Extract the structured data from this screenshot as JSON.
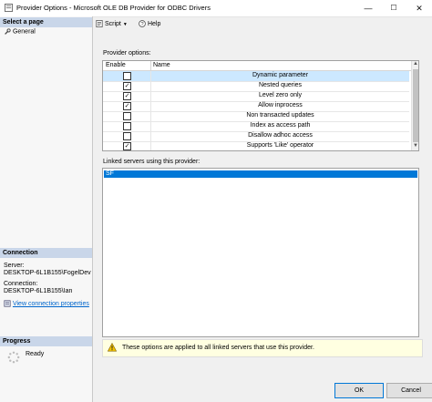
{
  "window": {
    "title": "Provider Options - Microsoft OLE DB Provider for ODBC Drivers",
    "minimize": "—",
    "maximize": "☐",
    "close": "✕"
  },
  "left": {
    "select_page_header": "Select a page",
    "pages": [
      {
        "label": "General",
        "icon": "wrench-icon"
      }
    ],
    "connection_header": "Connection",
    "server_label": "Server:",
    "server_value": "DESKTOP-6L1B155\\FogelDev",
    "connection_label": "Connection:",
    "connection_value": "DESKTOP-6L1B155\\Ian",
    "view_props_link": "View connection properties",
    "progress_header": "Progress",
    "progress_status": "Ready"
  },
  "toolbar": {
    "script_label": "Script",
    "help_label": "Help"
  },
  "options": {
    "label": "Provider options:",
    "columns": [
      "Enable",
      "Name"
    ],
    "rows": [
      {
        "name": "Dynamic parameter",
        "checked": false,
        "selected": true
      },
      {
        "name": "Nested queries",
        "checked": true,
        "selected": false
      },
      {
        "name": "Level zero only",
        "checked": true,
        "selected": false
      },
      {
        "name": "Allow inprocess",
        "checked": true,
        "selected": false
      },
      {
        "name": "Non transacted updates",
        "checked": false,
        "selected": false
      },
      {
        "name": "Index as access path",
        "checked": false,
        "selected": false
      },
      {
        "name": "Disallow adhoc access",
        "checked": false,
        "selected": false
      },
      {
        "name": "Supports 'Like' operator",
        "checked": true,
        "selected": false
      }
    ]
  },
  "linked": {
    "label": "Linked servers using this provider:",
    "servers": [
      "SF"
    ]
  },
  "info": {
    "text": "These options are applied to all linked servers that use this provider."
  },
  "buttons": {
    "ok": "OK",
    "cancel": "Cancel"
  },
  "colors": {
    "selection": "#0078d7",
    "row_highlight": "#cce8ff",
    "section_header": "#c9d6e9",
    "info_bg": "#ffffe1"
  }
}
